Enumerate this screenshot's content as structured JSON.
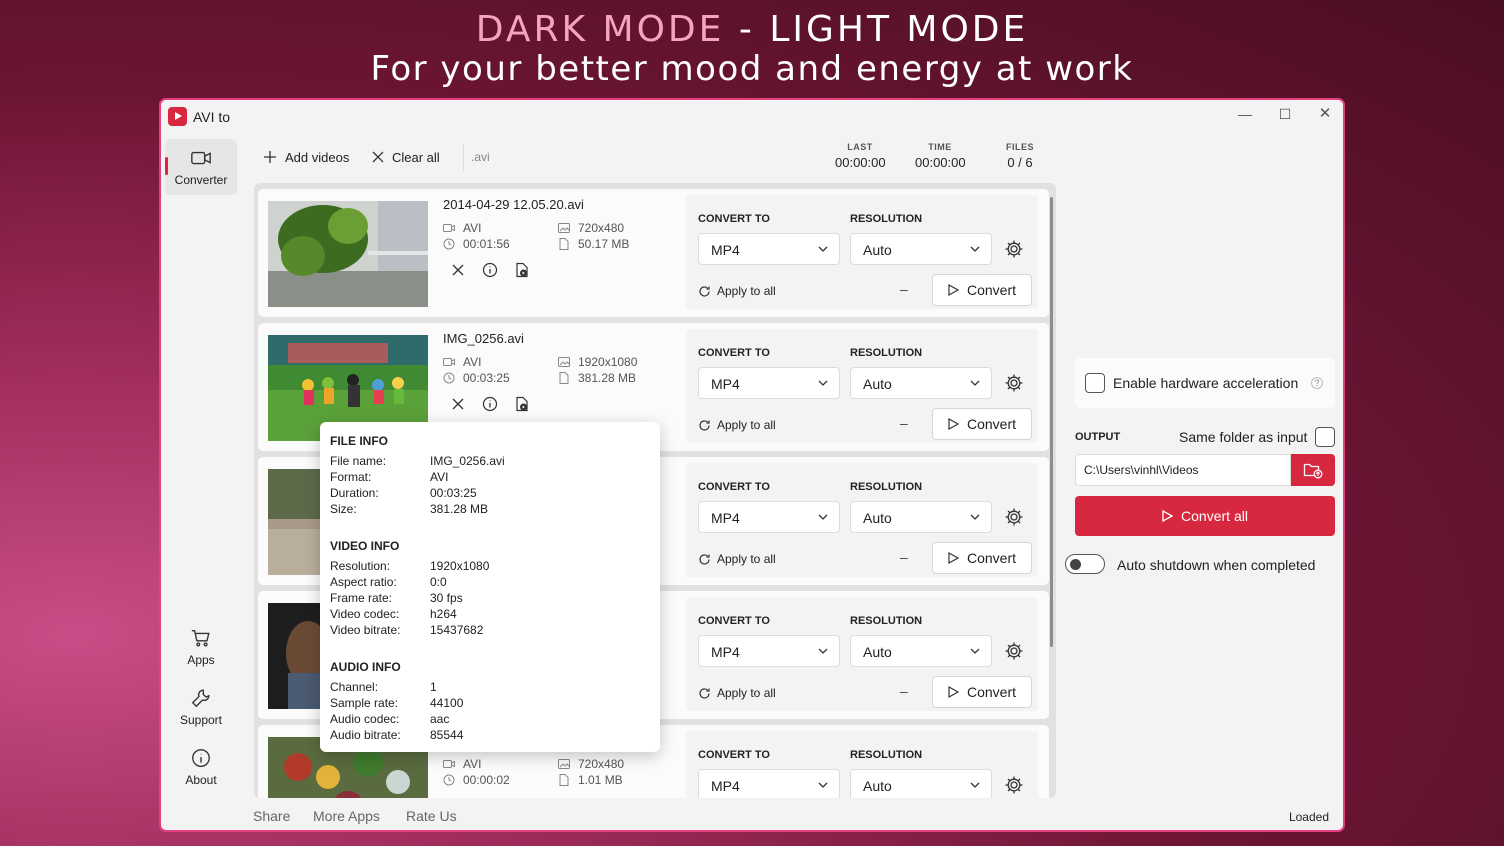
{
  "headline": {
    "dark": "DARK MODE",
    "dash": "-",
    "light": "LIGHT MODE",
    "subtitle": "For your better mood and energy at work"
  },
  "window": {
    "title": "AVI to",
    "min": "—",
    "max": "☐",
    "close": "✕"
  },
  "nav": {
    "converter": "Converter",
    "apps": "Apps",
    "support": "Support",
    "about": "About"
  },
  "toolbar": {
    "add_videos": "Add videos",
    "clear_all": "Clear all",
    "extension": ".avi"
  },
  "stats": [
    {
      "label": "LAST",
      "value": "00:00:00"
    },
    {
      "label": "TIME",
      "value": "00:00:00"
    },
    {
      "label": "FILES",
      "value": "0 / 6"
    }
  ],
  "labels": {
    "convert_to": "CONVERT TO",
    "resolution": "RESOLUTION",
    "apply_to_all": "Apply to all",
    "convert": "Convert",
    "dash": "–"
  },
  "files": [
    {
      "name": "2014-04-29 12.05.20.avi",
      "format": "AVI",
      "duration": "00:01:56",
      "resolution": "720x480",
      "size": "50.17 MB",
      "convert_to": "MP4",
      "out_resolution": "Auto"
    },
    {
      "name": "IMG_0256.avi",
      "format": "AVI",
      "duration": "00:03:25",
      "resolution": "1920x1080",
      "size": "381.28 MB",
      "convert_to": "MP4",
      "out_resolution": "Auto"
    },
    {
      "name": "",
      "format": "",
      "duration": "",
      "resolution": "",
      "size": "",
      "convert_to": "MP4",
      "out_resolution": "Auto"
    },
    {
      "name": "",
      "format": "",
      "duration": "",
      "resolution": "",
      "size": "",
      "convert_to": "MP4",
      "out_resolution": "Auto"
    },
    {
      "name": "",
      "format": "AVI",
      "duration": "00:00:02",
      "resolution": "720x480",
      "size": "1.01 MB",
      "convert_to": "MP4",
      "out_resolution": "Auto"
    }
  ],
  "popup": {
    "file_info": "FILE INFO",
    "file_rows": [
      [
        "File name:",
        "IMG_0256.avi"
      ],
      [
        "Format:",
        "AVI"
      ],
      [
        "Duration:",
        "00:03:25"
      ],
      [
        "Size:",
        "381.28 MB"
      ]
    ],
    "video_info": "VIDEO INFO",
    "video_rows": [
      [
        "Resolution:",
        "1920x1080"
      ],
      [
        "Aspect ratio:",
        "0:0"
      ],
      [
        "Frame rate:",
        "30 fps"
      ],
      [
        "Video codec:",
        "h264"
      ],
      [
        "Video bitrate:",
        "15437682"
      ]
    ],
    "audio_info": "AUDIO INFO",
    "audio_rows": [
      [
        "Channel:",
        "1"
      ],
      [
        "Sample rate:",
        "44100"
      ],
      [
        "Audio codec:",
        "aac"
      ],
      [
        "Audio bitrate:",
        "85544"
      ]
    ]
  },
  "settings": {
    "hw_accel": "Enable hardware acceleration",
    "help": "?",
    "output_label": "OUTPUT",
    "same_folder": "Same folder as input",
    "output_path": "C:\\Users\\vinhl\\Videos",
    "convert_all": "Convert all",
    "auto_shutdown": "Auto shutdown when completed"
  },
  "footer": {
    "share": "Share",
    "more_apps": "More Apps",
    "rate_us": "Rate Us",
    "status": "Loaded"
  },
  "colors": {
    "accent": "#d7283f",
    "window_border": "#e2407f",
    "headline_pink": "#f4a3c1"
  }
}
